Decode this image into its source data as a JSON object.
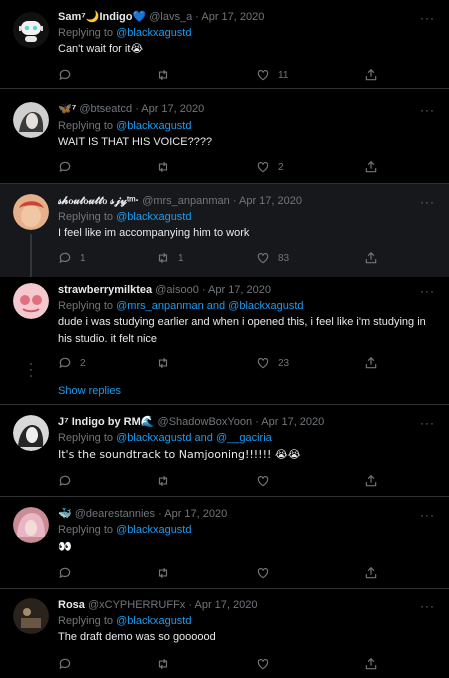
{
  "tweets": [
    {
      "name": "Sam⁷🌙Indigo💙",
      "handle": "@lavs_a",
      "dot": "·",
      "date": "Apr 17, 2020",
      "reply_prefix": "Replying to",
      "reply_to": "@blackxagustd",
      "text": "Can't wait for it😭",
      "replies": "",
      "retweets": "",
      "likes": "11"
    },
    {
      "name": "🦋⁷",
      "handle": "@btseatcd",
      "dot": "·",
      "date": "Apr 17, 2020",
      "reply_prefix": "Replying to",
      "reply_to": "@blackxagustd",
      "text": "WAIT IS THAT HIS VOICE????",
      "replies": "",
      "retweets": "",
      "likes": "2"
    },
    {
      "name": "𝓈𝒽ℴ𝓊𝓉ℴ𝓊𝓉𝓉ℴ 𝓈𝒿𝓎ᵗᵐ·",
      "handle": "@mrs_anpanman",
      "dot": "·",
      "date": "Apr 17, 2020",
      "reply_prefix": "Replying to",
      "reply_to": "@blackxagustd",
      "text": "I feel like im accompanying him to work",
      "replies": "1",
      "retweets": "1",
      "likes": "83"
    },
    {
      "name": "strawberrymilktea",
      "handle": "@aisoo0",
      "dot": "·",
      "date": "Apr 17, 2020",
      "reply_prefix": "Replying to",
      "reply_to": "@mrs_anpanman and @blackxagustd",
      "text": "dude i was studying earlier and when i opened this, i feel like i'm studying in his studio. it felt nice",
      "replies": "2",
      "retweets": "",
      "likes": "23"
    },
    {
      "name": "J⁷ Indigo by RM🌊",
      "handle": "@ShadowBoxYoon",
      "dot": "·",
      "date": "Apr 17, 2020",
      "reply_prefix": "Replying to",
      "reply_to": "@blackxagustd and @__gaciria",
      "text": "It's the soundtrack to Namjooning!!!!!! 😭😭",
      "replies": "",
      "retweets": "",
      "likes": ""
    },
    {
      "name": "🐳",
      "handle": "@dearestannies",
      "dot": "·",
      "date": "Apr 17, 2020",
      "reply_prefix": "Replying to",
      "reply_to": "@blackxagustd",
      "text": "👀",
      "replies": "",
      "retweets": "",
      "likes": ""
    },
    {
      "name": "Rosa",
      "handle": "@xCYPHERRUFFx",
      "dot": "·",
      "date": "Apr 17, 2020",
      "reply_prefix": "Replying to",
      "reply_to": "@blackxagustd",
      "text": "The draft demo was so goooood",
      "replies": "",
      "retweets": "",
      "likes": ""
    }
  ],
  "show_replies": "Show replies",
  "more_glyph": "···",
  "colors": {
    "background": "#000000",
    "highlight": "#16181c",
    "link": "#1d9bf0",
    "muted": "#71767b",
    "text": "#e7e9ea"
  },
  "icons": [
    "reply-icon",
    "retweet-icon",
    "like-icon",
    "share-icon",
    "more-icon"
  ]
}
